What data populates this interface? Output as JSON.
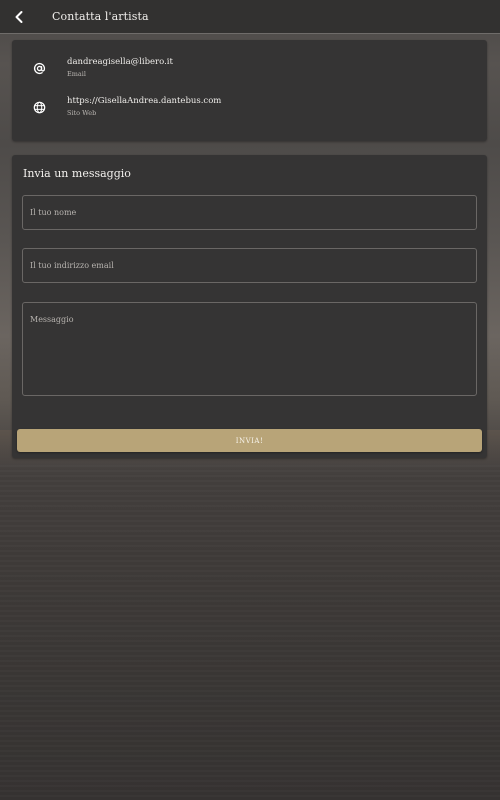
{
  "header": {
    "title": "Contatta l'artista",
    "back_icon": "chevron-left-icon"
  },
  "contact": {
    "email": {
      "value": "dandreagisella@libero.it",
      "label": "Email",
      "icon": "at-icon"
    },
    "website": {
      "value": "https://GisellaAndrea.dantebus.com",
      "label": "Sito Web",
      "icon": "globe-icon"
    }
  },
  "message_form": {
    "heading": "Invia un messaggio",
    "name_placeholder": "Il tuo nome",
    "email_placeholder": "Il tuo indirizzo email",
    "message_placeholder": "Messaggio",
    "submit_label": "INVIA!"
  },
  "colors": {
    "accent": "#b8a478",
    "appbar": "#323130",
    "card": "#353434"
  }
}
